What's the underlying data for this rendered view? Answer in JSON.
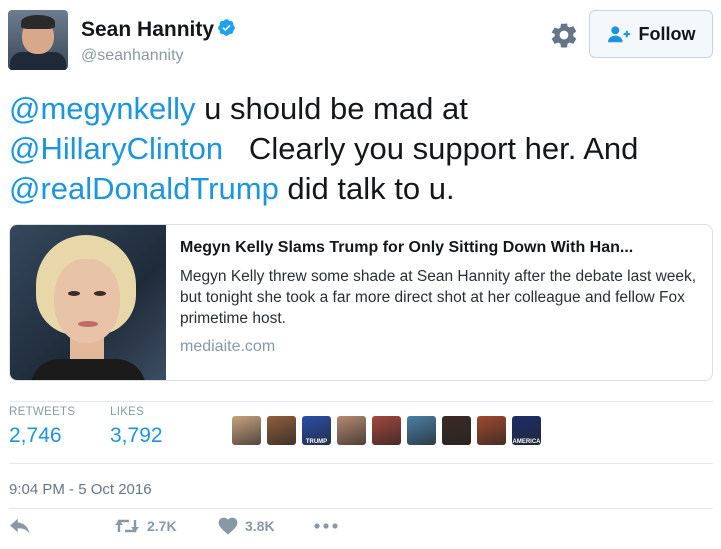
{
  "tweet": {
    "author_name": "Sean Hannity",
    "author_handle": "@seanhannity",
    "follow_label": "Follow",
    "text_parts": [
      {
        "type": "mention",
        "text": "@megynkelly"
      },
      {
        "type": "text",
        "text": " u should be mad at "
      },
      {
        "type": "mention",
        "text": "@HillaryClinton"
      },
      {
        "type": "text",
        "text": "   Clearly you support her. And "
      },
      {
        "type": "mention",
        "text": "@realDonaldTrump"
      },
      {
        "type": "text",
        "text": " did talk to u."
      }
    ],
    "timestamp": "9:04 PM - 5 Oct 2016"
  },
  "card": {
    "title": "Megyn Kelly Slams Trump for Only Sitting Down With Han...",
    "description": "Megyn Kelly threw some shade at Sean Hannity after the debate last week, but tonight she took a far more direct shot at her colleague and fellow Fox primetime host.",
    "domain": "mediaite.com"
  },
  "stats": {
    "retweets_label": "RETWEETS",
    "retweets_value": "2,746",
    "likes_label": "LIKES",
    "likes_value": "3,792"
  },
  "likers": [
    {
      "name": "liker-avatar",
      "color": "#c9a27e",
      "text": ""
    },
    {
      "name": "liker-avatar",
      "color": "#8f5d3c",
      "text": ""
    },
    {
      "name": "liker-avatar",
      "color": "#2a4fa8",
      "text": "TRUMP"
    },
    {
      "name": "liker-avatar",
      "color": "#b58a72",
      "text": ""
    },
    {
      "name": "liker-avatar",
      "color": "#a3473c",
      "text": ""
    },
    {
      "name": "liker-avatar",
      "color": "#4a7fa6",
      "text": ""
    },
    {
      "name": "liker-avatar",
      "color": "#3b2a24",
      "text": ""
    },
    {
      "name": "liker-avatar",
      "color": "#a04a2e",
      "text": ""
    },
    {
      "name": "liker-avatar",
      "color": "#1c2f6b",
      "text": "AMERICA"
    }
  ],
  "actions": {
    "retweet_count": "2.7K",
    "like_count": "3.8K"
  },
  "icons": {
    "verified": "verified-badge-icon",
    "settings": "gear-icon",
    "follow": "add-user-icon",
    "reply": "reply-icon",
    "retweet": "retweet-icon",
    "like": "heart-icon",
    "more": "more-dots-icon"
  },
  "colors": {
    "link": "#1b95e0",
    "muted": "#8899a6",
    "text": "#14171a"
  }
}
